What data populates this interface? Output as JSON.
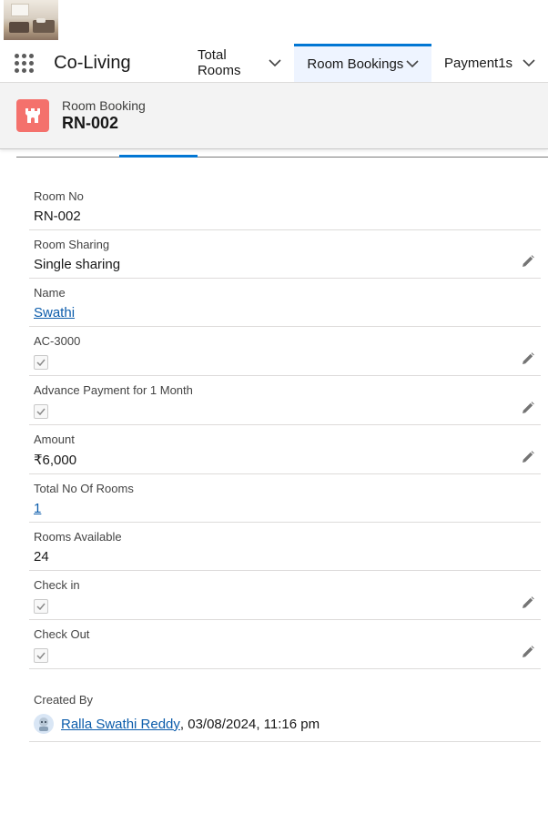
{
  "nav": {
    "app_name": "Co-Living",
    "tabs": [
      {
        "label": "Total Rooms"
      },
      {
        "label": "Room Bookings"
      },
      {
        "label": "Payment1s"
      }
    ]
  },
  "header": {
    "object_type": "Room Booking",
    "record_name": "RN-002"
  },
  "fields": {
    "room_no": {
      "label": "Room No",
      "value": "RN-002"
    },
    "room_sharing": {
      "label": "Room Sharing",
      "value": "Single sharing"
    },
    "name": {
      "label": "Name",
      "value": "Swathi"
    },
    "ac": {
      "label": "AC-3000",
      "checked": true
    },
    "advance": {
      "label": "Advance Payment for 1 Month",
      "checked": true
    },
    "amount": {
      "label": "Amount",
      "value": "₹6,000"
    },
    "total_rooms": {
      "label": "Total No Of Rooms",
      "value": "1"
    },
    "rooms_available": {
      "label": "Rooms Available",
      "value": "24"
    },
    "check_in": {
      "label": "Check in",
      "checked": true
    },
    "check_out": {
      "label": "Check Out",
      "checked": true
    },
    "created_by": {
      "label": "Created By",
      "user": "Ralla Swathi Reddy",
      "timestamp": ", 03/08/2024, 11:16 pm"
    }
  },
  "icons": {
    "app_launcher": "waffle-icon",
    "record": "castle-icon",
    "edit": "pencil-icon",
    "chevron": "chevron-down-icon",
    "check": "check-icon"
  },
  "colors": {
    "accent": "#0176d3",
    "record_icon_bg": "#f4716c",
    "link": "#0b5cab",
    "active_tab_bg": "#eef4ff"
  }
}
